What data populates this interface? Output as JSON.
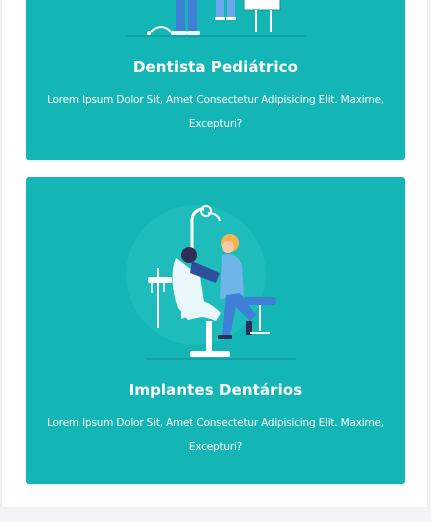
{
  "cards": [
    {
      "title": "Dentista Pediátrico",
      "description": "Lorem Ipsum Dolor Sit, Amet Consectetur Adipisicing Elit. Maxime, Excepturi?",
      "illustration_icon": "pediatric-dentist-illustration"
    },
    {
      "title": "Implantes Dentários",
      "description": "Lorem Ipsum Dolor Sit, Amet Consectetur Adipisicing Elit. Maxime, Excepturi?",
      "illustration_icon": "dentist-chair-illustration"
    }
  ],
  "colors": {
    "card_background": "#14b5b5",
    "page_background": "#f2f3f5",
    "text": "#ffffff",
    "illustration_blue": "#3f7fd8",
    "illustration_light": "#dff6f6"
  }
}
